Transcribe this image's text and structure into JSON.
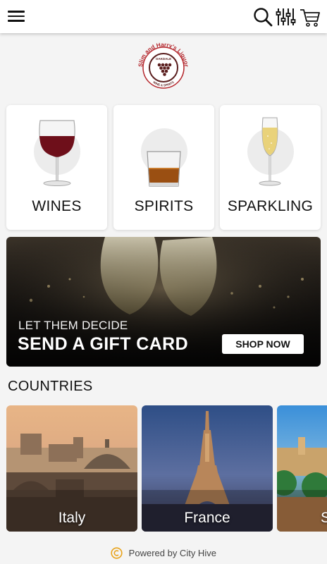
{
  "header": {
    "menu_icon": "hamburger-menu-icon",
    "search_icon": "search-icon",
    "filter_icon": "filter-sliders-icon",
    "cart_icon": "shopping-cart-icon"
  },
  "logo": {
    "text_top": "Slim and Harry's Liquor",
    "text_center": "OAKDALE",
    "text_bottom": "WINE & SPIRITS",
    "brand_color": "#b5282e"
  },
  "categories": [
    {
      "label": "WINES",
      "icon": "red-wine-glass-icon"
    },
    {
      "label": "SPIRITS",
      "icon": "whiskey-tumbler-icon"
    },
    {
      "label": "SPARKLING",
      "icon": "champagne-flute-icon"
    }
  ],
  "banner": {
    "kicker": "LET THEM DECIDE",
    "headline": "SEND A GIFT CARD",
    "button": "SHOP NOW"
  },
  "countries": {
    "title": "COUNTRIES",
    "items": [
      {
        "name": "Italy"
      },
      {
        "name": "France"
      },
      {
        "name": "S"
      }
    ]
  },
  "footer": {
    "text": "Powered by City Hive",
    "accent": "#e8a21a"
  }
}
